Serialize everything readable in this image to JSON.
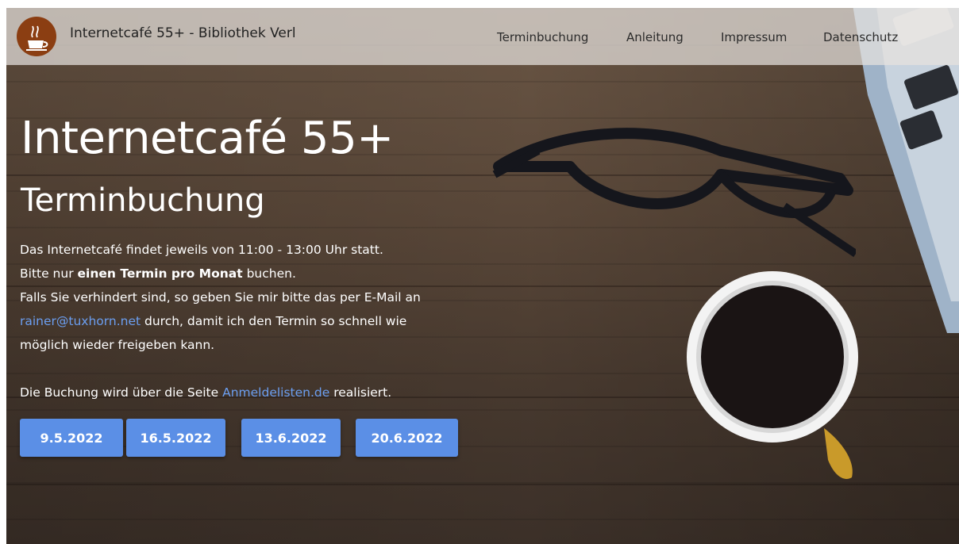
{
  "navbar": {
    "brand": "Internetcafé 55+ - Bibliothek Verl",
    "logo_icon": "coffee-cup-icon",
    "items": [
      "Terminbuchung",
      "Anleitung",
      "Impressum",
      "Datenschutz"
    ]
  },
  "hero": {
    "title": "Internetcafé 55+",
    "subtitle": "Terminbuchung",
    "line1": "Das Internetcafé findet jeweils von 11:00 - 13:00 Uhr statt.",
    "line2_pre": "Bitte nur ",
    "line2_bold": "einen Termin pro Monat",
    "line2_post": " buchen.",
    "line3": "Falls Sie verhindert sind, so geben Sie mir bitte das per E-Mail an",
    "email": "rainer@tuxhorn.net",
    "line4_post": " durch, damit ich den Termin so schnell wie",
    "line5": "möglich wieder freigeben kann.",
    "line6_pre": "Die Buchung wird über die Seite ",
    "link": "Anmeldelisten.de",
    "line6_post": " realisiert."
  },
  "dates": [
    "9.5.2022",
    "16.5.2022",
    "13.6.2022",
    "20.6.2022"
  ],
  "colors": {
    "accent": "#5b8fe6",
    "link": "#6b9ef0",
    "logo": "#8b3e12"
  }
}
